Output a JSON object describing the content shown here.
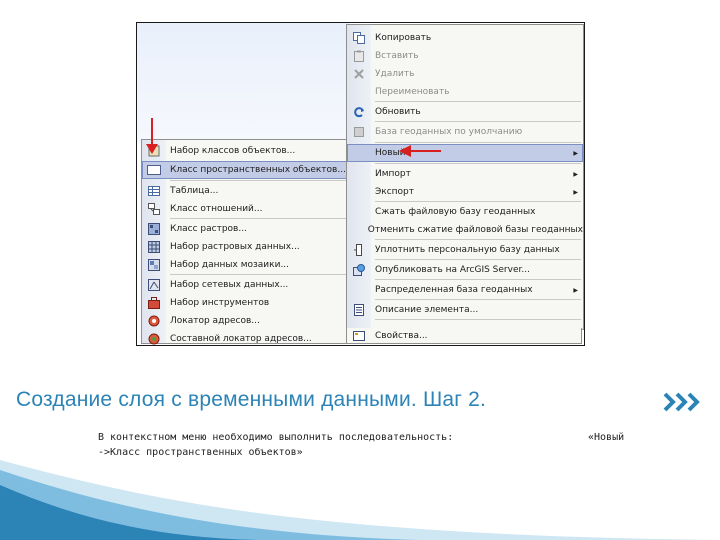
{
  "left_menu": {
    "items": [
      {
        "label": "Набор классов объектов...",
        "icon": "feature-dataset-icon"
      },
      {
        "label": "Класс пространственных объектов...",
        "icon": "feature-class-icon",
        "selected": true
      },
      {
        "label": "Таблица...",
        "icon": "table-icon"
      },
      {
        "label": "Класс отношений...",
        "icon": "relationship-class-icon"
      },
      {
        "label": "Класс растров...",
        "icon": "raster-catalog-icon"
      },
      {
        "label": "Набор растровых данных...",
        "icon": "raster-dataset-icon"
      },
      {
        "label": "Набор данных мозаики...",
        "icon": "mosaic-dataset-icon"
      },
      {
        "label": "Набор сетевых данных...",
        "icon": "network-dataset-icon"
      },
      {
        "label": "Набор инструментов",
        "icon": "toolbox-icon"
      },
      {
        "label": "Локатор адресов...",
        "icon": "address-locator-icon"
      },
      {
        "label": "Составной локатор адресов...",
        "icon": "composite-locator-icon"
      }
    ]
  },
  "right_menu": {
    "items": [
      {
        "label": "Копировать",
        "icon": "copy-icon",
        "disabled": false
      },
      {
        "label": "Вставить",
        "icon": "paste-icon",
        "disabled": true
      },
      {
        "label": "Удалить",
        "icon": "delete-icon",
        "disabled": true
      },
      {
        "label": "Переименовать",
        "icon": "",
        "disabled": true
      },
      {
        "label": "Обновить",
        "icon": "refresh-icon",
        "disabled": false
      },
      {
        "label": "База геоданных по умолчанию",
        "icon": "geodatabase-icon",
        "disabled": true
      },
      {
        "label": "Новый",
        "icon": "",
        "disabled": false,
        "submenu": true,
        "selected": true
      },
      {
        "label": "Импорт",
        "icon": "",
        "disabled": false,
        "submenu": true
      },
      {
        "label": "Экспорт",
        "icon": "",
        "disabled": false,
        "submenu": true
      },
      {
        "label": "Сжать файловую базу геоданных",
        "icon": "",
        "disabled": false
      },
      {
        "label": "Отменить сжатие файловой базы геоданных",
        "icon": "",
        "disabled": false
      },
      {
        "label": "Уплотнить персональную базу данных",
        "icon": "compact-icon",
        "disabled": false
      },
      {
        "label": "Опубликовать на ArcGIS Server...",
        "icon": "publish-icon",
        "disabled": false
      },
      {
        "label": "Распределенная база геоданных",
        "icon": "",
        "disabled": false,
        "submenu": true
      },
      {
        "label": "Описание элемента...",
        "icon": "item-description-icon",
        "disabled": false
      },
      {
        "label": "Свойства...",
        "icon": "properties-icon",
        "disabled": false
      }
    ]
  },
  "slide": {
    "title": "Создание слоя с временными данными. Шаг 2.",
    "description_line1": "В контекстном меню необходимо выполнить последовательность:",
    "description_line1_tail": "«Новый",
    "description_line2": "->Класс пространственных объектов»"
  },
  "colors": {
    "title": "#2c83b6",
    "arrow": "#d92020",
    "selection": "#c3cce6"
  }
}
